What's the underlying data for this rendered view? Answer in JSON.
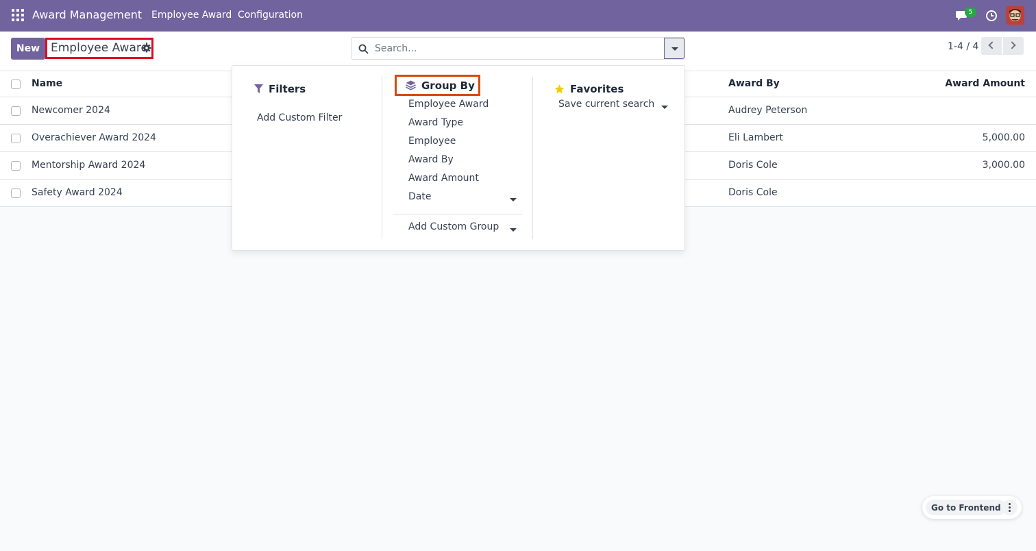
{
  "navbar": {
    "app_name": "Award Management",
    "menu": [
      "Employee Award",
      "Configuration"
    ],
    "chat_badge": "5"
  },
  "control_panel": {
    "new_label": "New",
    "breadcrumb": "Employee Award",
    "search_placeholder": "Search...",
    "pager": "1-4 / 4"
  },
  "table": {
    "headers": {
      "name": "Name",
      "award_by": "Award By",
      "award_amount": "Award Amount"
    },
    "rows": [
      {
        "name": "Newcomer 2024",
        "award_by": "Audrey Peterson",
        "award_amount": ""
      },
      {
        "name": "Overachiever Award 2024",
        "award_by": "Eli Lambert",
        "award_amount": "5,000.00"
      },
      {
        "name": "Mentorship Award 2024",
        "award_by": "Doris Cole",
        "award_amount": "3,000.00"
      },
      {
        "name": "Safety Award 2024",
        "award_by": "Doris Cole",
        "award_amount": ""
      }
    ]
  },
  "search_panel": {
    "filters": {
      "title": "Filters",
      "items": [
        "Add Custom Filter"
      ]
    },
    "group_by": {
      "title": "Group By",
      "items": [
        "Employee Award",
        "Award Type",
        "Employee",
        "Award By",
        "Award Amount",
        "Date"
      ],
      "custom": "Add Custom Group"
    },
    "favorites": {
      "title": "Favorites",
      "items": [
        "Save current search"
      ]
    }
  },
  "floating": {
    "go_frontend": "Go to Frontend"
  },
  "colors": {
    "brand": "#71639e",
    "breadcrumb_highlight": "#e00b1f",
    "groupby_highlight": "#d84a0b",
    "badge": "#28a745"
  }
}
